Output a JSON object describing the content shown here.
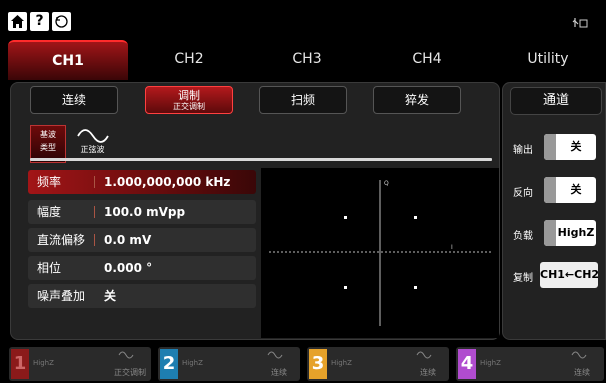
{
  "colors": {
    "accent": "#b3191c",
    "ch1": "#8b1a1a",
    "ch2": "#2aa0d8",
    "ch3": "#e6a22a",
    "ch4": "#b04ccf"
  },
  "topbar": {
    "help_label": "?",
    "home_icon": "home-icon",
    "back_icon": "back-icon",
    "usb_icon": "usb-icon"
  },
  "tabs": [
    {
      "label": "CH1",
      "active": true
    },
    {
      "label": "CH2"
    },
    {
      "label": "CH3"
    },
    {
      "label": "CH4"
    },
    {
      "label": "Utility"
    }
  ],
  "modes": {
    "continuous": "连续",
    "modulate": "调制",
    "modulate_sub": "正交调制",
    "sweep": "扫频",
    "burst": "猝发"
  },
  "base_wave": {
    "line1": "基波",
    "line2": "类型",
    "type_label": "正弦波",
    "icon": "sine-wave-icon"
  },
  "params": [
    {
      "label": "频率",
      "value": "1.000,000,000 kHz",
      "active": true
    },
    {
      "label": "幅度",
      "value": "100.0 mVpp"
    },
    {
      "label": "直流偏移",
      "value": "0.0 mV"
    },
    {
      "label": "相位",
      "value": "0.000 °"
    },
    {
      "label": "噪声叠加",
      "value": "关"
    }
  ],
  "iq_view": {
    "q_label": "Q",
    "i_label": "I"
  },
  "side": {
    "title": "通道",
    "output_label": "输出",
    "output_value": "关",
    "invert_label": "反向",
    "invert_value": "关",
    "load_label": "负载",
    "load_value": "HighZ",
    "copy_label": "复制",
    "copy_value": "CH1←CH2"
  },
  "channels": [
    {
      "num": "1",
      "load": "HighZ",
      "mode": "正交调制"
    },
    {
      "num": "2",
      "load": "HighZ",
      "mode": "连续"
    },
    {
      "num": "3",
      "load": "HighZ",
      "mode": "连续"
    },
    {
      "num": "4",
      "load": "HighZ",
      "mode": "连续"
    }
  ]
}
